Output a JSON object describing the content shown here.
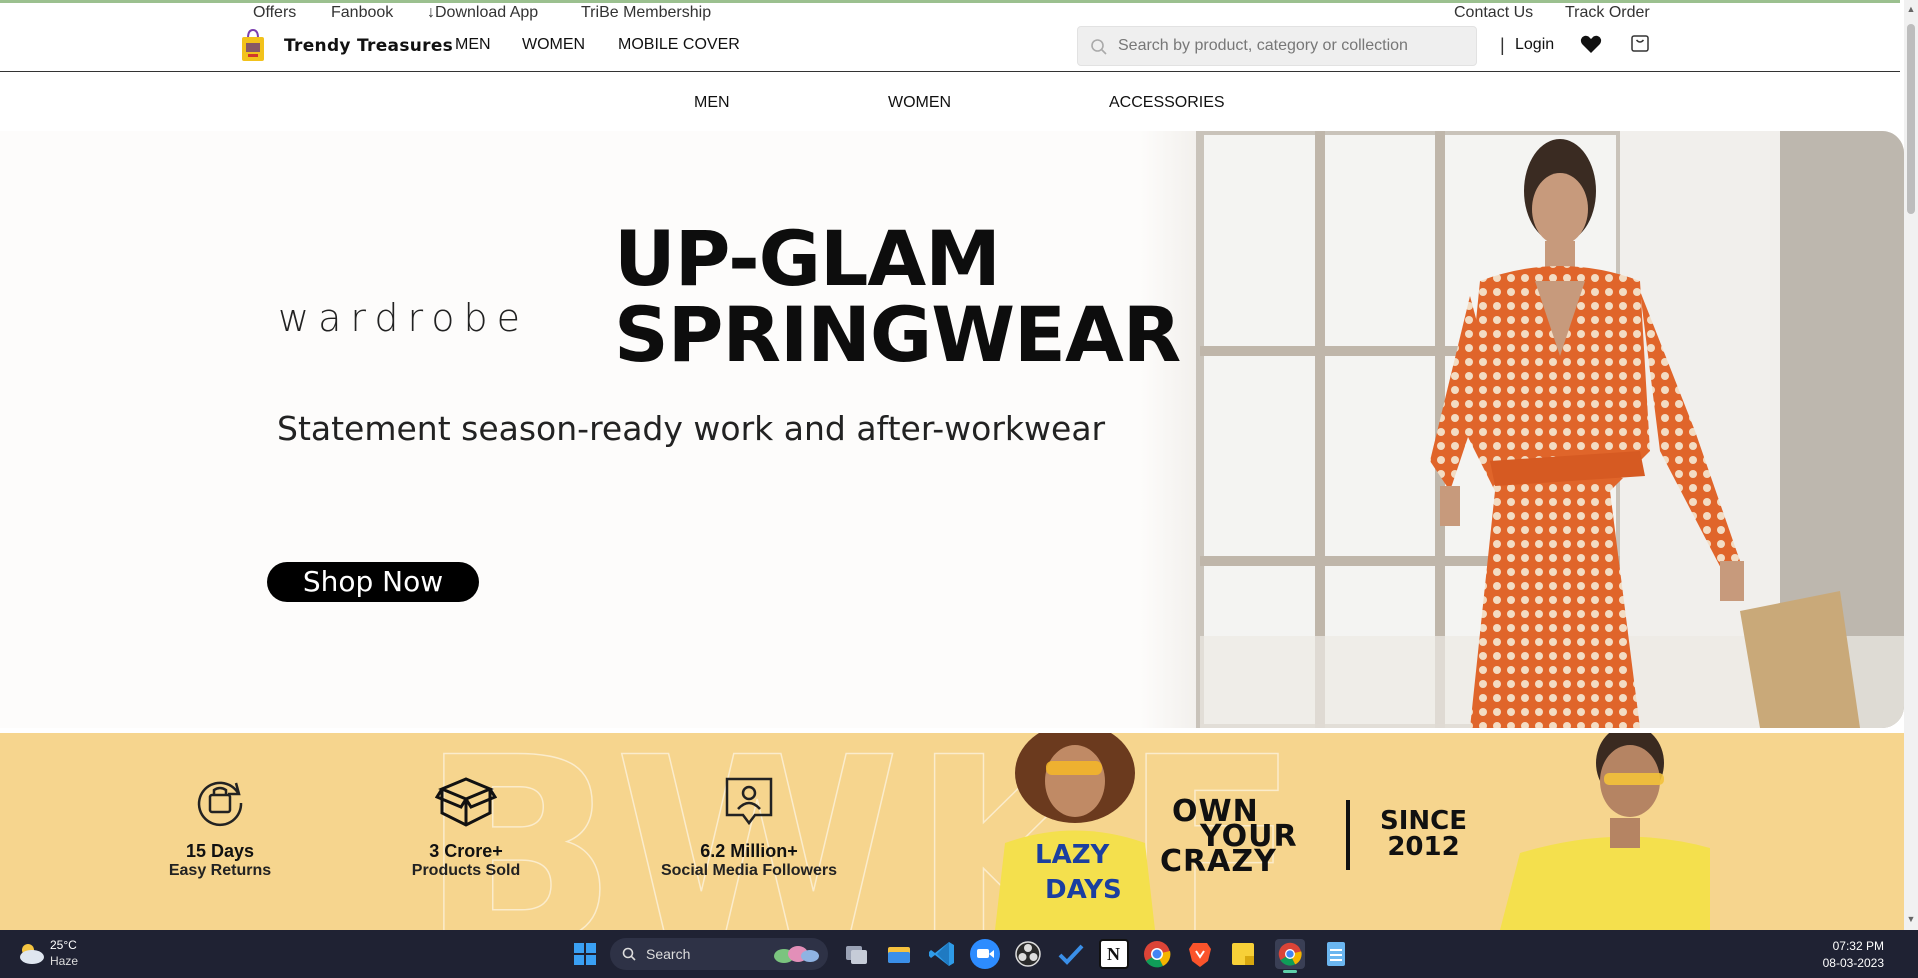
{
  "topbar": {
    "left_links": [
      "Offers",
      "Fanbook",
      "↓Download App",
      "TriBe Membership"
    ],
    "right_links": [
      "Contact Us",
      "Track Order"
    ]
  },
  "header": {
    "brand": "Trendy Treasures",
    "nav": [
      "MEN",
      "WOMEN",
      "MOBILE COVER"
    ],
    "search_placeholder": "Search by product, category or collection",
    "separator": "|",
    "login": "Login",
    "icons": [
      "search-icon",
      "heart-icon",
      "shopping-bag-icon"
    ]
  },
  "category_nav": [
    "MEN",
    "WOMEN",
    "ACCESSORIES"
  ],
  "hero": {
    "brand_word": "wardrobe",
    "headline_line1": "UP-GLAM",
    "headline_line2": "SPRINGWEAR",
    "subline": "Statement season-ready work and after-workwear",
    "cta": "Shop Now"
  },
  "stats_band": {
    "stats": [
      {
        "icon": "returns-icon",
        "number": "15 Days",
        "label": "Easy Returns"
      },
      {
        "icon": "box-icon",
        "number": "3 Crore+",
        "label": "Products Sold"
      },
      {
        "icon": "followers-icon",
        "number": "6.2 Million+",
        "label": "Social Media Followers"
      }
    ],
    "slogan_lines": [
      "OWN",
      "YOUR",
      "CRAZY"
    ],
    "since_lines": [
      "SINCE",
      "2012"
    ],
    "tshirt_print": [
      "LAZY",
      "DAYS"
    ],
    "colors": {
      "band": "#f6d58e",
      "tshirt": "#f4e04d"
    }
  },
  "taskbar": {
    "weather_temp": "25°C",
    "weather_desc": "Haze",
    "search_label": "Search",
    "time": "07:32 PM",
    "date": "08-03-2023",
    "apps": [
      "windows-start-icon",
      "task-view-icon",
      "file-explorer-icon",
      "vscode-icon",
      "zoom-icon",
      "obs-icon",
      "todo-icon",
      "notion-icon",
      "chrome-icon",
      "brave-icon",
      "sticky-notes-icon",
      "chrome-active-icon",
      "notepad-icon"
    ]
  },
  "colors": {
    "hero_dress": "#e0652a",
    "taskbar": "#1f2233"
  }
}
